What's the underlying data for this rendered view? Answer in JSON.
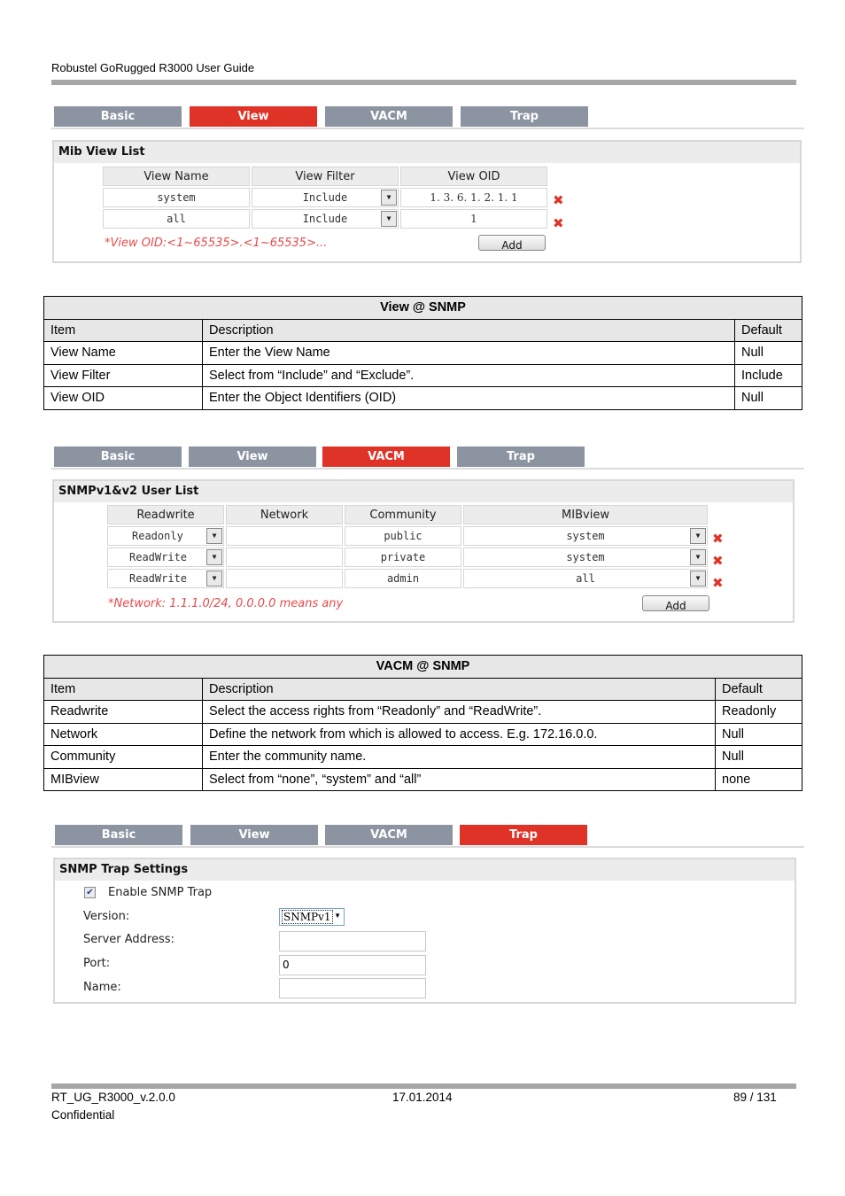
{
  "header": {
    "doc_title": "Robustel GoRugged R3000 User Guide"
  },
  "tabs": [
    "Basic",
    "View",
    "VACM",
    "Trap"
  ],
  "view_section": {
    "active_tab": "View",
    "panel_title": "Mib View List",
    "columns": [
      "View Name",
      "View Filter",
      "View OID"
    ],
    "rows": [
      {
        "name": "system",
        "filter": "Include",
        "oid": "1. 3. 6. 1. 2. 1. 1"
      },
      {
        "name": "all",
        "filter": "Include",
        "oid": "1"
      }
    ],
    "hint": "*View OID:<1~65535>.<1~65535>...",
    "add_label": "Add",
    "delete_icon": "x-delete-icon"
  },
  "view_table": {
    "title": "View @ SNMP",
    "header": [
      "Item",
      "Description",
      "Default"
    ],
    "rows": [
      [
        "View Name",
        "Enter the View Name",
        "Null"
      ],
      [
        "View Filter",
        "Select from “Include” and “Exclude”.",
        "Include"
      ],
      [
        "View OID",
        "Enter the Object Identifiers (OID)",
        "Null"
      ]
    ]
  },
  "vacm_section": {
    "active_tab": "VACM",
    "panel_title": "SNMPv1&v2 User List",
    "columns": [
      "Readwrite",
      "Network",
      "Community",
      "MIBview"
    ],
    "rows": [
      {
        "readwrite": "Readonly",
        "network": "",
        "community": "public",
        "mibview": "system"
      },
      {
        "readwrite": "ReadWrite",
        "network": "",
        "community": "private",
        "mibview": "system"
      },
      {
        "readwrite": "ReadWrite",
        "network": "",
        "community": "admin",
        "mibview": "all"
      }
    ],
    "hint": "*Network: 1.1.1.0/24, 0.0.0.0 means any",
    "add_label": "Add"
  },
  "vacm_table": {
    "title": "VACM @ SNMP",
    "header": [
      "Item",
      "Description",
      "Default"
    ],
    "rows": [
      [
        "Readwrite",
        "Select the access rights from “Readonly” and “ReadWrite”.",
        "Readonly"
      ],
      [
        "Network",
        "Define the network from which is allowed to access. E.g. 172.16.0.0.",
        "Null"
      ],
      [
        "Community",
        "Enter the community name.",
        "Null"
      ],
      [
        "MIBview",
        "Select from “none”, “system” and “all”",
        "none"
      ]
    ]
  },
  "trap_section": {
    "active_tab": "Trap",
    "panel_title": "SNMP Trap Settings",
    "enable_label": "Enable SNMP Trap",
    "enable_checked": true,
    "version_label": "Version:",
    "version_value": "SNMPv1",
    "server_label": "Server Address:",
    "server_value": "",
    "port_label": "Port:",
    "port_value": "0",
    "name_label": "Name:",
    "name_value": ""
  },
  "footer": {
    "doc_id": "RT_UG_R3000_v.2.0.0",
    "date": "17.01.2014",
    "page": "89 / 131",
    "classification": "Confidential"
  },
  "colors": {
    "active_tab": "#e03327",
    "inactive_tab": "#8c94a2",
    "hint": "#e84a4a"
  }
}
